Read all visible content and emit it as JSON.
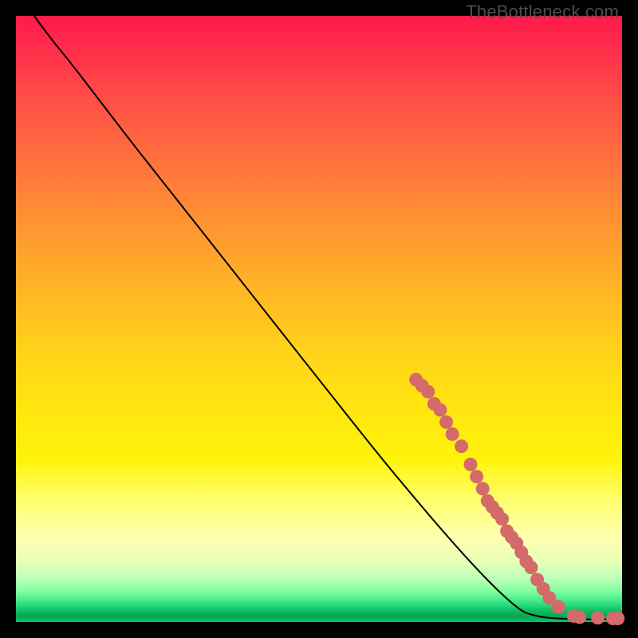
{
  "watermark": "TheBottleneck.com",
  "colors": {
    "curve_stroke": "#000000",
    "marker_fill": "#d46a6a",
    "marker_stroke": "#c05a5a"
  },
  "chart_data": {
    "type": "line",
    "title": "",
    "xlabel": "",
    "ylabel": "",
    "xlim": [
      0,
      100
    ],
    "ylim": [
      0,
      100
    ],
    "curve": [
      {
        "x": 3,
        "y": 100
      },
      {
        "x": 6,
        "y": 96
      },
      {
        "x": 10,
        "y": 91
      },
      {
        "x": 20,
        "y": 78
      },
      {
        "x": 35,
        "y": 59
      },
      {
        "x": 50,
        "y": 40
      },
      {
        "x": 62,
        "y": 25
      },
      {
        "x": 74,
        "y": 11
      },
      {
        "x": 82,
        "y": 3
      },
      {
        "x": 86,
        "y": 1
      },
      {
        "x": 92,
        "y": 0.5
      },
      {
        "x": 99,
        "y": 0.5
      }
    ],
    "markers": [
      {
        "x": 66,
        "y": 40
      },
      {
        "x": 67,
        "y": 39
      },
      {
        "x": 68,
        "y": 38
      },
      {
        "x": 69,
        "y": 36
      },
      {
        "x": 70,
        "y": 35
      },
      {
        "x": 71,
        "y": 33
      },
      {
        "x": 72,
        "y": 31
      },
      {
        "x": 73.5,
        "y": 29
      },
      {
        "x": 75,
        "y": 26
      },
      {
        "x": 76,
        "y": 24
      },
      {
        "x": 77,
        "y": 22
      },
      {
        "x": 77.8,
        "y": 20
      },
      {
        "x": 78.6,
        "y": 19
      },
      {
        "x": 79.4,
        "y": 18
      },
      {
        "x": 80.2,
        "y": 17
      },
      {
        "x": 81,
        "y": 15
      },
      {
        "x": 81.8,
        "y": 14
      },
      {
        "x": 82.6,
        "y": 13
      },
      {
        "x": 83.4,
        "y": 11.5
      },
      {
        "x": 84.2,
        "y": 10
      },
      {
        "x": 85,
        "y": 9
      },
      {
        "x": 86,
        "y": 7
      },
      {
        "x": 87,
        "y": 5.5
      },
      {
        "x": 88,
        "y": 4
      },
      {
        "x": 89.5,
        "y": 2.5
      },
      {
        "x": 92,
        "y": 1
      },
      {
        "x": 93,
        "y": 0.8
      },
      {
        "x": 96,
        "y": 0.7
      },
      {
        "x": 98.5,
        "y": 0.6
      },
      {
        "x": 99.3,
        "y": 0.6
      }
    ]
  }
}
